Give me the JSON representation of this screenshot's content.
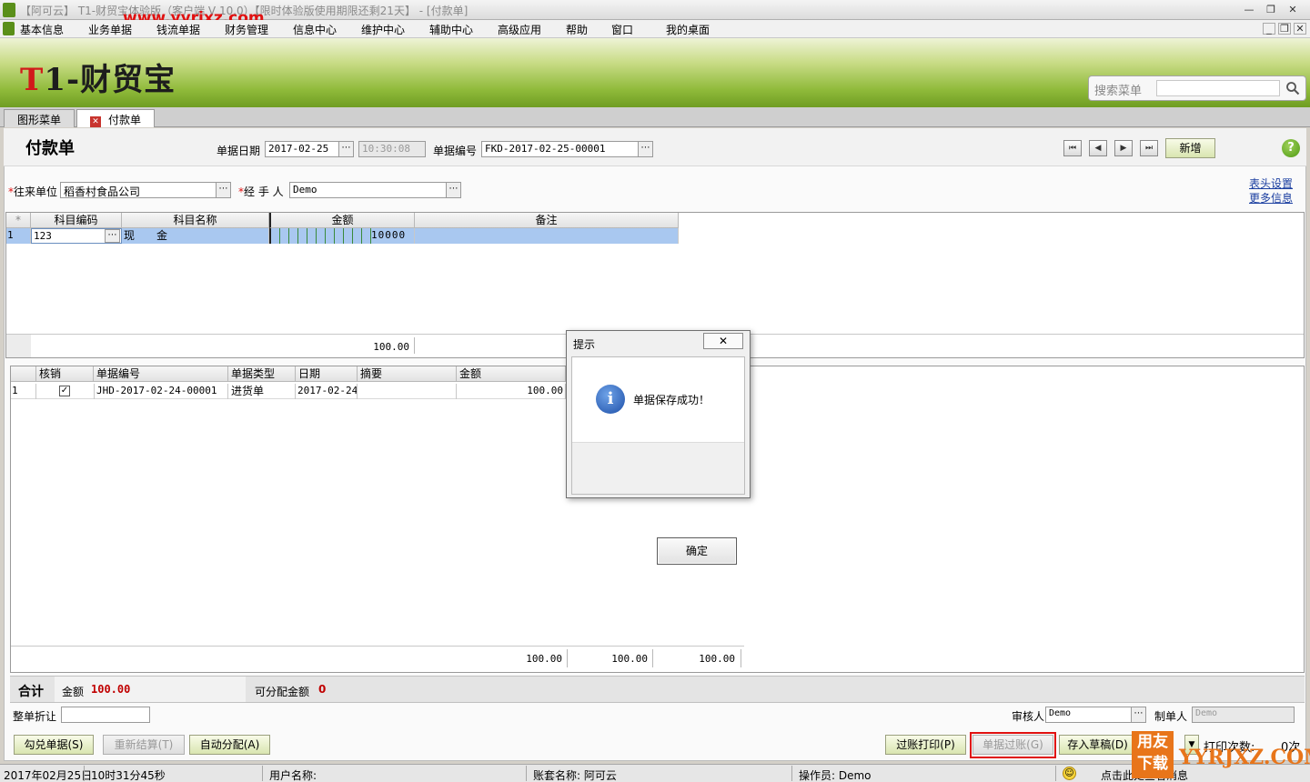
{
  "window": {
    "title": "【阿可云】 T1-财贸宝体验版（客户端 V 10.0）【限时体验版使用期限还剩21天】 - [付款单]",
    "watermark": "www.yyrjxz.com"
  },
  "menu": [
    "基本信息",
    "业务单据",
    "钱流单据",
    "财务管理",
    "信息中心",
    "维护中心",
    "辅助中心",
    "高级应用",
    "帮助",
    "窗口",
    "我的桌面"
  ],
  "banner": {
    "logo_t": "T",
    "logo_rest": "1-财贸宝",
    "search_label": "搜索菜单",
    "search_value": ""
  },
  "tabs": [
    {
      "label": "图形菜单"
    },
    {
      "label": "付款单"
    }
  ],
  "form": {
    "title": "付款单",
    "date_label": "单据日期",
    "date_value": "2017-02-25",
    "time_value": "10:30:08",
    "no_label": "单据编号",
    "no_value": "FKD-2017-02-25-00001",
    "new_button": "新增",
    "partner_label": "往来单位",
    "partner_value": "稻香村食品公司",
    "handler_label": "经 手 人",
    "handler_value": "Demo",
    "header_settings": "表头设置",
    "more_info": "更多信息"
  },
  "grid1": {
    "headers": [
      "*",
      "科目编码",
      "科目名称",
      "金额",
      "备注"
    ],
    "rows": [
      {
        "no": "1",
        "code": "123",
        "name": "现　　金",
        "amount": "10000",
        "note": ""
      }
    ],
    "footer_total": "100.00"
  },
  "grid2": {
    "headers": [
      "",
      "核销",
      "单据编号",
      "单据类型",
      "日期",
      "摘要",
      "金额"
    ],
    "rows": [
      {
        "no": "1",
        "checked": true,
        "doc_no": "JHD-2017-02-24-00001",
        "type": "进货单",
        "date": "2017-02-24",
        "summary": "",
        "amount": "100.00"
      }
    ],
    "footer": [
      "100.00",
      "100.00",
      "100.00"
    ]
  },
  "totals": {
    "label": "合计",
    "amount_label": "金额",
    "amount_value": "100.00",
    "alloc_label": "可分配金额",
    "alloc_value": "0"
  },
  "bottom": {
    "discount_label": "整单折让",
    "discount_value": "",
    "auditor_label": "审核人",
    "auditor_value": "Demo",
    "maker_label": "制单人",
    "maker_value": "Demo",
    "btn_match": "勾兑单据(S)",
    "btn_recalc": "重新结算(T)",
    "btn_auto": "自动分配(A)",
    "btn_post_print": "过账打印(P)",
    "btn_post": "单据过账(G)",
    "btn_draft": "存入草稿(D)",
    "print_count_label": "打印次数:",
    "print_count_value": "0次"
  },
  "dialog": {
    "title": "提示",
    "message": "单据保存成功！",
    "ok": "确定",
    "icon": "info-icon"
  },
  "status": {
    "date": "2017年02月25日",
    "elapsed": "10时31分45秒",
    "user": "用户名称:",
    "account": "账套名称: 阿可云",
    "operator": "操作员: Demo",
    "hint": "点击此处查看消息"
  },
  "brand": {
    "cn_top": "用友",
    "cn_bottom": "下载",
    "en": "YYRJXZ.COM"
  },
  "colors": {
    "banner_green": "#8fba3a",
    "accent_red": "#e01010",
    "selection_blue": "#a9c8f0",
    "total_red": "#c00000"
  }
}
